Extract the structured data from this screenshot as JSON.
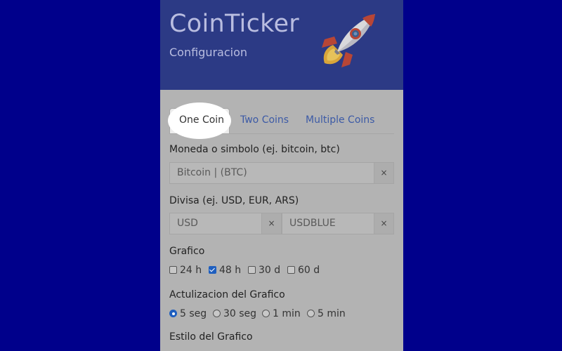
{
  "app": {
    "title": "CoinTicker",
    "subtitle": "Configuracion",
    "logo_icon": "rocket-icon"
  },
  "tabs": [
    {
      "label": "One Coin",
      "active": true
    },
    {
      "label": "Two Coins",
      "active": false
    },
    {
      "label": "Multiple Coins",
      "active": false
    }
  ],
  "coin": {
    "label": "Moneda o simbolo (ej. bitcoin, btc)",
    "value": "Bitcoin | (BTC)",
    "clear": "×"
  },
  "currency": {
    "label": "Divisa (ej. USD, EUR, ARS)",
    "primary": "USD",
    "secondary": "USDBLUE",
    "clear": "×"
  },
  "chart": {
    "label": "Grafico",
    "options": [
      {
        "label": "24 h",
        "checked": false
      },
      {
        "label": "48 h",
        "checked": true
      },
      {
        "label": "30 d",
        "checked": false
      },
      {
        "label": "60 d",
        "checked": false
      }
    ]
  },
  "update": {
    "label": "Actulizacion del Grafico",
    "options": [
      {
        "label": "5 seg",
        "checked": true
      },
      {
        "label": "30 seg",
        "checked": false
      },
      {
        "label": "1 min",
        "checked": false
      },
      {
        "label": "5 min",
        "checked": false
      }
    ]
  },
  "style": {
    "label": "Estilo del Grafico"
  },
  "colors": {
    "background": "#00008b",
    "header": "#2c3a85",
    "accent": "#1f5fbf",
    "link": "#3c5aa6"
  }
}
